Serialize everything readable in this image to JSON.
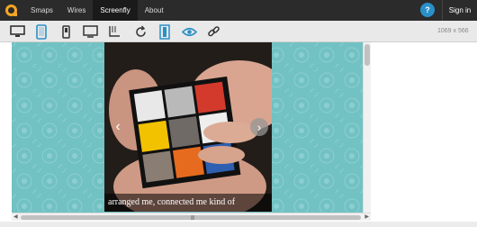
{
  "nav": {
    "logo": "screenfly-logo",
    "items": [
      {
        "label": "Smaps",
        "active": false
      },
      {
        "label": "Wires",
        "active": false
      },
      {
        "label": "Screenfly",
        "active": true
      },
      {
        "label": "About",
        "active": false
      }
    ],
    "help_label": "?",
    "signin_label": "Sign in"
  },
  "toolbar": {
    "tools": [
      "desktop-icon",
      "tablet-icon",
      "mobile-icon",
      "tv-icon",
      "custom-size-icon",
      "rotate-icon",
      "scroll-toggle-icon",
      "preview-eye-icon",
      "share-link-icon"
    ],
    "selected_tool": "tablet-icon",
    "dimensions": "1069 x 566"
  },
  "content": {
    "caption": "arranged me, connected me kind of",
    "prev_label": "‹",
    "next_label": "›"
  },
  "colors": {
    "nav_bg": "#2b2b2b",
    "accent": "#2a8fc9",
    "viewport_bg": "#72c1c3",
    "logo": "#f5a623"
  }
}
